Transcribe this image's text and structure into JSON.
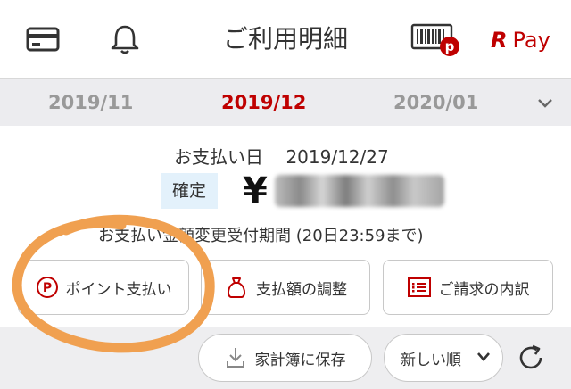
{
  "header": {
    "title": "ご利用明細",
    "rpay_r": "R",
    "rpay_text": "Pay",
    "icons": [
      "card-icon",
      "bell-icon",
      "barcode-point-icon"
    ],
    "point_badge": "p"
  },
  "months": {
    "prev": "2019/11",
    "current": "2019/12",
    "next": "2020/01"
  },
  "summary": {
    "pay_date_label": "お支払い日",
    "pay_date": "2019/12/27",
    "status_badge": "確定",
    "currency": "¥",
    "change_period": "お支払い金額変更受付期間 (20日23:59まで)"
  },
  "actions": {
    "point_payment": "ポイント支払い",
    "point_icon_letter": "P",
    "adjust_amount": "支払額の調整",
    "billing_breakdown": "ご請求の内訳"
  },
  "toolbar": {
    "save_household": "家計簿に保存",
    "sort_label": "新しい順"
  },
  "colors": {
    "brand_red": "#bf0000",
    "month_bg": "#ececef",
    "badge_bg": "#e3f1fb",
    "annotation_orange": "#f0a050"
  }
}
